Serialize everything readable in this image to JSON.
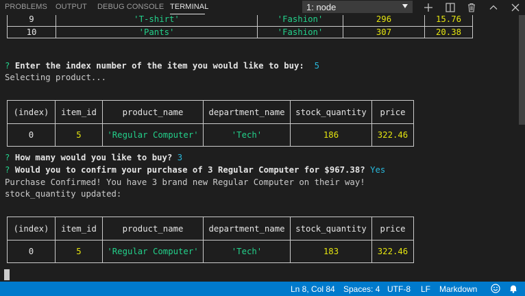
{
  "panel": {
    "tabs": [
      "PROBLEMS",
      "OUTPUT",
      "DEBUG CONSOLE",
      "TERMINAL"
    ],
    "active_tab": "TERMINAL",
    "terminal_select": "1: node",
    "icons": [
      "plus-icon",
      "split-icon",
      "trash-icon",
      "chevron-up-icon",
      "close-icon"
    ]
  },
  "top_table": {
    "rows": [
      [
        "9",
        "'T-shirt'",
        "'Fashion'",
        "296",
        "15.76"
      ],
      [
        "10",
        "'Pants'",
        "'Fashion'",
        "307",
        "20.38"
      ]
    ]
  },
  "prompt1": {
    "mark": "?",
    "question": "Enter the index number of the item you would like to buy:",
    "answer": "5"
  },
  "selecting": "Selecting product...",
  "product_table_1": {
    "headers": [
      "(index)",
      "item_id",
      "product_name",
      "department_name",
      "stock_quantity",
      "price"
    ],
    "row": [
      "0",
      "5",
      "'Regular Computer'",
      "'Tech'",
      "186",
      "322.46"
    ]
  },
  "prompt2": {
    "mark": "?",
    "question": "How many would you like to buy?",
    "answer": "3"
  },
  "prompt3": {
    "mark": "?",
    "question": "Would you to confirm your purchase of 3 Regular Computer for $967.38?",
    "answer": "Yes"
  },
  "confirm_msg": "Purchase Confirmed! You have 3 brand new Regular Computer on their way!",
  "updated_msg": "stock_quantity updated:",
  "product_table_2": {
    "headers": [
      "(index)",
      "item_id",
      "product_name",
      "department_name",
      "stock_quantity",
      "price"
    ],
    "row": [
      "0",
      "5",
      "'Regular Computer'",
      "'Tech'",
      "183",
      "322.46"
    ]
  },
  "statusbar": {
    "position": "Ln 8, Col 84",
    "spaces": "Spaces: 4",
    "encoding": "UTF-8",
    "eol": "LF",
    "language": "Markdown"
  },
  "colors": {
    "string_green": "#23d18b",
    "number_yellow": "#e5e510",
    "answer_cyan": "#29b8db",
    "status_blue": "#007acc"
  }
}
